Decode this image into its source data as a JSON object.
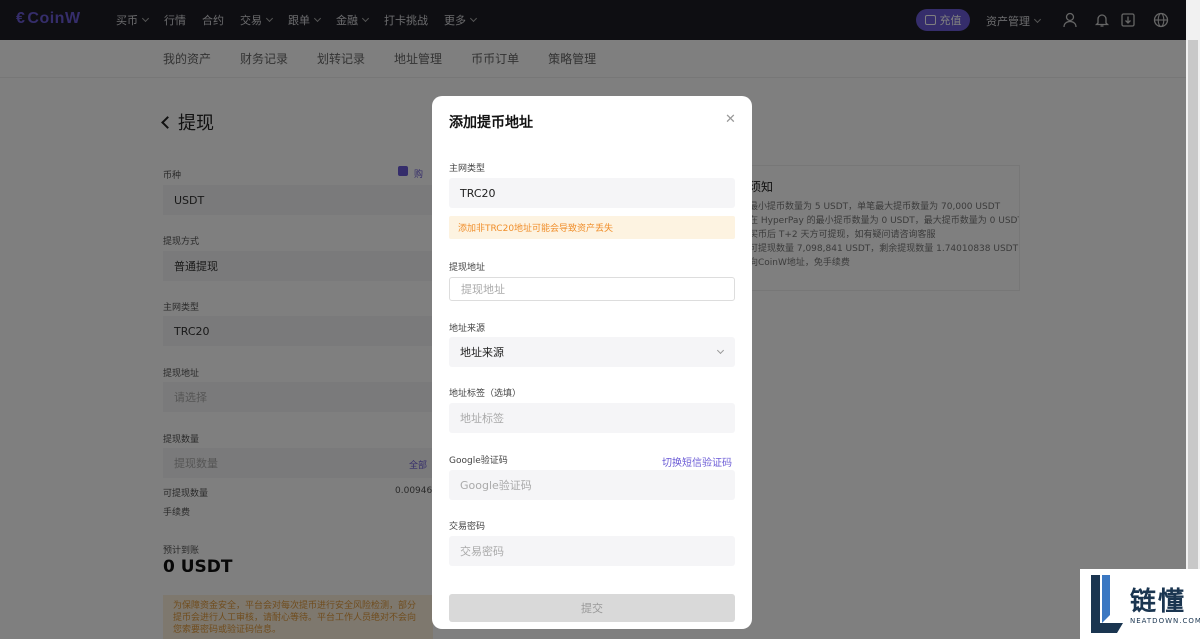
{
  "topnav": {
    "logo": "CoinW",
    "items": [
      {
        "label": "买币",
        "dropdown": true
      },
      {
        "label": "行情",
        "dropdown": false
      },
      {
        "label": "合约",
        "dropdown": false
      },
      {
        "label": "交易",
        "dropdown": true
      },
      {
        "label": "跟单",
        "dropdown": true
      },
      {
        "label": "金融",
        "dropdown": true
      },
      {
        "label": "打卡挑战",
        "dropdown": false
      },
      {
        "label": "更多",
        "dropdown": true
      }
    ],
    "recharge_label": "充值",
    "assets_label": "资产管理"
  },
  "subnav": {
    "items": [
      "我的资产",
      "财务记录",
      "划转记录",
      "地址管理",
      "币币订单",
      "策略管理"
    ]
  },
  "page": {
    "title": "提现",
    "coin_label": "币种",
    "coin_value": "USDT",
    "method_label": "提现方式",
    "method_value": "普通提现",
    "network_label": "主网类型",
    "network_value": "TRC20",
    "address_label": "提现地址",
    "address_placeholder": "请选择",
    "amount_label": "提现数量",
    "amount_placeholder": "提现数量",
    "all_label": "全部",
    "available_label": "可提现数量",
    "available_value": "0.009462",
    "fee_label": "手续费",
    "expected_label": "预计到账",
    "expected_value": "0 USDT",
    "checkbox_label": "购",
    "warning_text": "为保障资金安全，平台会对每次提币进行安全风险检测，部分提币会进行人工审核，请耐心等待。平台工作人员绝对不会向您索要密码或验证码信息。"
  },
  "notice": {
    "title": "须知",
    "lines": [
      "最小提币数量为 5 USDT，单笔最大提币数量为 70,000 USDT",
      "在 HyperPay 的最小提币数量为 0 USDT，最大提币数量为 0 USDT",
      "买币后 T+2 天方可提现，如有疑问请咨询客服",
      "可提现数量 7,098,841 USDT，剩余提现数量 1.74010838 USDT",
      "向CoinW地址，免手续费"
    ]
  },
  "modal": {
    "title": "添加提币地址",
    "network_label": "主网类型",
    "network_value": "TRC20",
    "network_warning": "添加非TRC20地址可能会导致资产丢失",
    "address_label": "提现地址",
    "address_placeholder": "提现地址",
    "source_label": "地址来源",
    "source_placeholder": "地址来源",
    "tag_label": "地址标签（选填）",
    "tag_placeholder": "地址标签",
    "google_label": "Google验证码",
    "google_switch": "切换短信验证码",
    "google_placeholder": "Google验证码",
    "password_label": "交易密码",
    "password_placeholder": "交易密码",
    "submit_label": "提交"
  },
  "watermark": {
    "brand": "链懂",
    "sub": "NEATDOWN.COM"
  }
}
